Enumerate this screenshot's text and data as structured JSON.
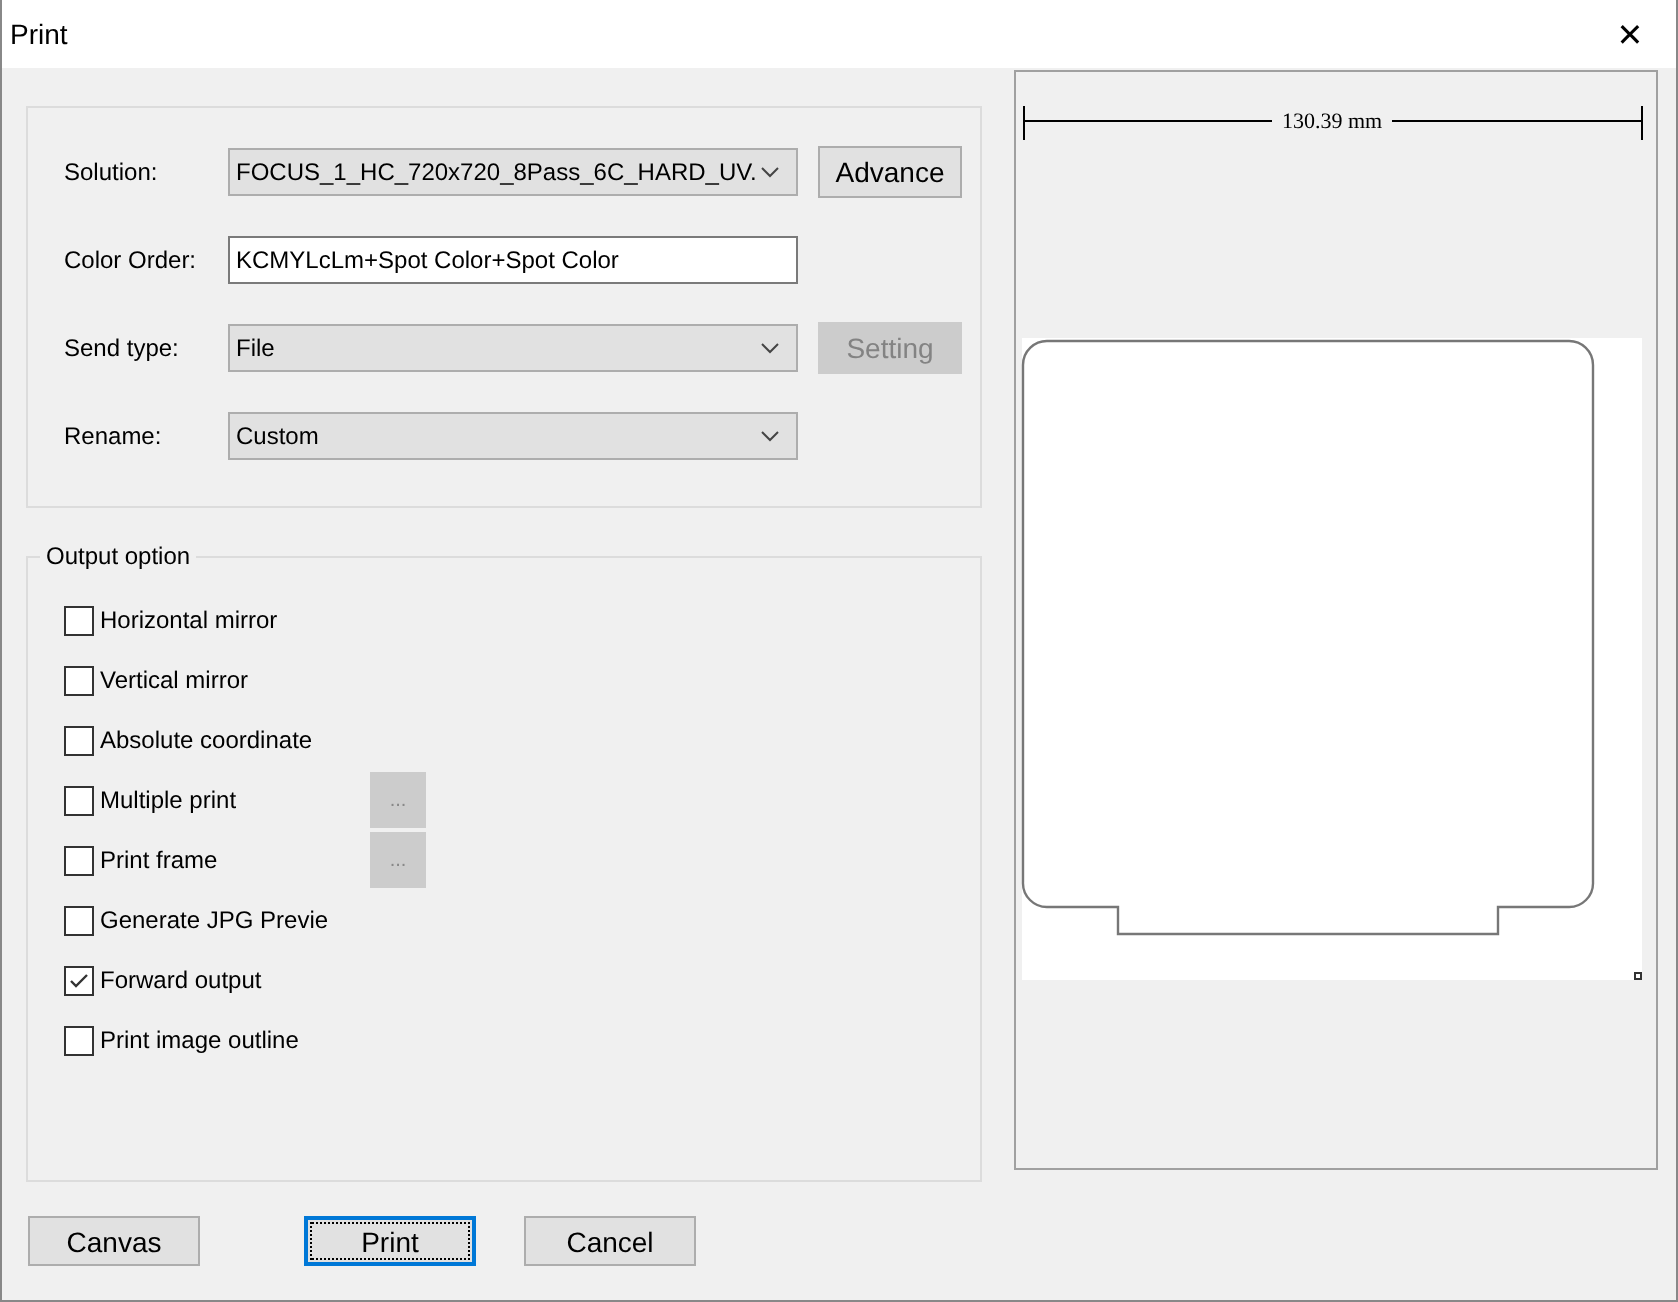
{
  "window": {
    "title": "Print",
    "close": "✕"
  },
  "settings": [
    {
      "kind": "dropdown",
      "label": "Solution:",
      "value": "FOCUS_1_HC_720x720_8Pass_6C_HARD_UV.",
      "button": {
        "label": "Advance",
        "disabled": false
      }
    },
    {
      "kind": "text",
      "label": "Color Order:",
      "value": "KCMYLcLm+Spot Color+Spot Color"
    },
    {
      "kind": "dropdown",
      "label": "Send type:",
      "value": "File",
      "button": {
        "label": "Setting",
        "disabled": true
      }
    },
    {
      "kind": "dropdown",
      "label": "Rename:",
      "value": "Custom"
    }
  ],
  "output_option": {
    "title": "Output option",
    "options": [
      {
        "label": "Horizontal mirror",
        "checked": false
      },
      {
        "label": "Vertical mirror",
        "checked": false
      },
      {
        "label": "Absolute coordinate",
        "checked": false
      },
      {
        "label": "Multiple print",
        "checked": false,
        "button": "..."
      },
      {
        "label": "Print frame",
        "checked": false,
        "button": "..."
      },
      {
        "label": "Generate JPG Previe",
        "checked": false
      },
      {
        "label": "Forward output",
        "checked": true
      },
      {
        "label": "Print image outline",
        "checked": false
      }
    ]
  },
  "preview": {
    "width_label": "130.39 mm"
  },
  "buttons": [
    {
      "label": "Canvas",
      "focused": false
    },
    {
      "label": "Print",
      "focused": true
    },
    {
      "label": "Cancel",
      "focused": false
    }
  ]
}
